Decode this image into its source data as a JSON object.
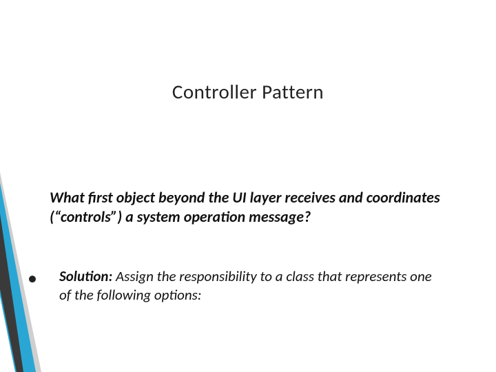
{
  "slide": {
    "title": "Controller Pattern",
    "question": "What first object beyond the UI layer receives and coordinates (“controls”) a system operation  message?",
    "bullet": {
      "label": "Solution: ",
      "text": " Assign the responsibility to a class that represents one of the following options:"
    }
  },
  "accent": {
    "blue": "#2aa6d4",
    "dark": "#3a3a3a",
    "grey": "#cfcfcf"
  }
}
